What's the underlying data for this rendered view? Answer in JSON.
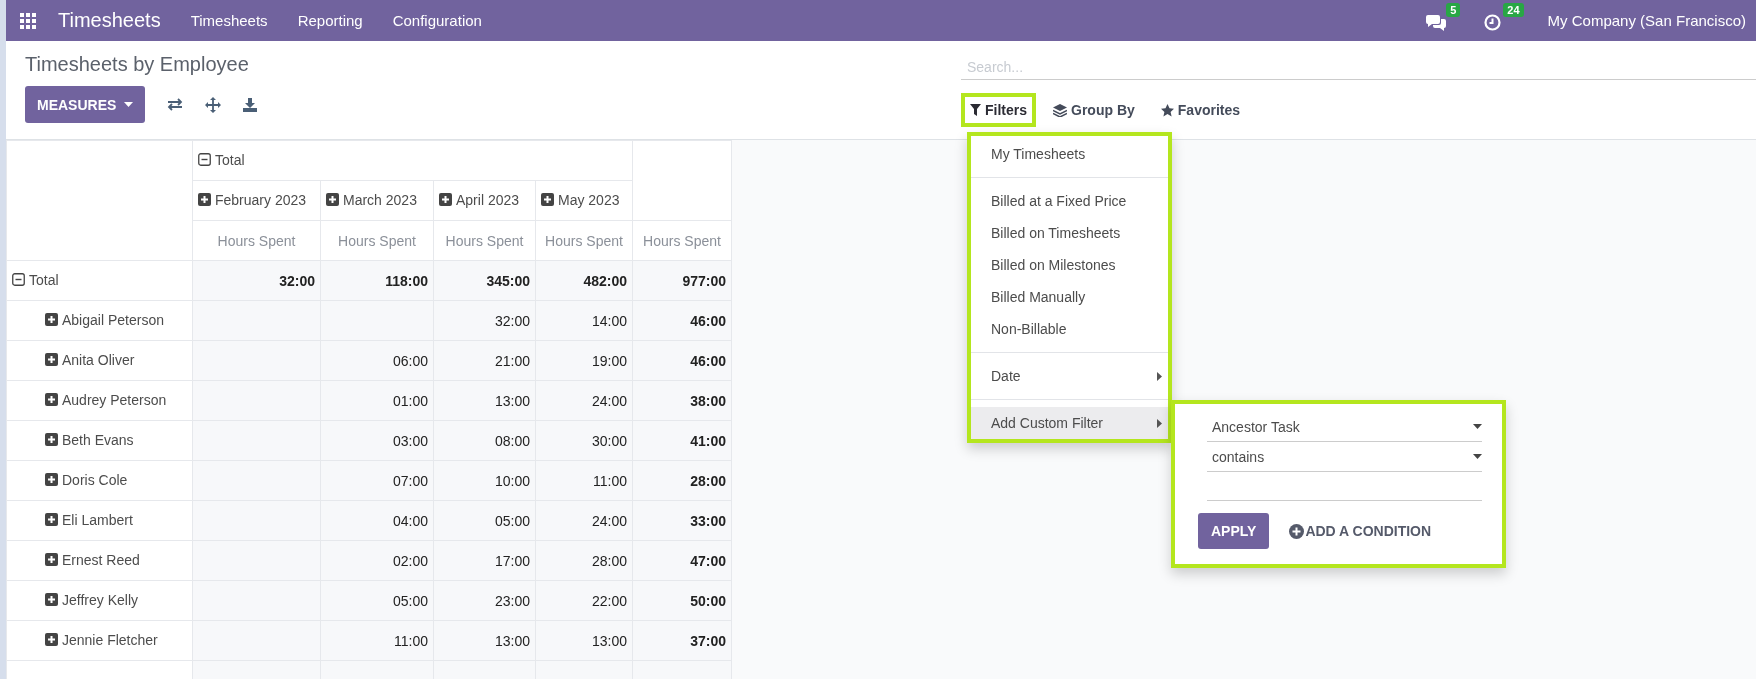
{
  "navbar": {
    "app_name": "Timesheets",
    "menus": [
      "Timesheets",
      "Reporting",
      "Configuration"
    ],
    "messages_count": "5",
    "activities_count": "24",
    "company": "My Company (San Francisco)"
  },
  "page_title": "Timesheets by Employee",
  "toolbar": {
    "measures_label": "MEASURES"
  },
  "search": {
    "placeholder": "Search..."
  },
  "filter_tabs": [
    {
      "label": "Filters",
      "selected": true
    },
    {
      "label": "Group By",
      "selected": false
    },
    {
      "label": "Favorites",
      "selected": false
    }
  ],
  "filter_menu": {
    "groups": [
      [
        {
          "label": "My Timesheets",
          "submenu": false,
          "selected": false
        }
      ],
      [
        {
          "label": "Billed at a Fixed Price",
          "submenu": false,
          "selected": false
        },
        {
          "label": "Billed on Timesheets",
          "submenu": false,
          "selected": false
        },
        {
          "label": "Billed on Milestones",
          "submenu": false,
          "selected": false
        },
        {
          "label": "Billed Manually",
          "submenu": false,
          "selected": false
        },
        {
          "label": "Non-Billable",
          "submenu": false,
          "selected": false
        }
      ],
      [
        {
          "label": "Date",
          "submenu": true,
          "selected": false
        }
      ],
      [
        {
          "label": "Add Custom Filter",
          "submenu": true,
          "selected": true
        }
      ]
    ]
  },
  "custom_filter": {
    "field": "Ancestor Task",
    "operator": "contains",
    "apply_label": "APPLY",
    "add_condition_label": "ADD A CONDITION"
  },
  "pivot": {
    "column_header": {
      "label": "Total",
      "expanded": true
    },
    "months": [
      {
        "label": "February 2023",
        "expanded": false
      },
      {
        "label": "March 2023",
        "expanded": false
      },
      {
        "label": "April 2023",
        "expanded": false
      },
      {
        "label": "May 2023",
        "expanded": false
      }
    ],
    "measures": [
      "Hours Spent",
      "Hours Spent",
      "Hours Spent",
      "Hours Spent",
      "Hours Spent"
    ],
    "total_row": {
      "label": "Total",
      "expanded": true,
      "values": [
        "32:00",
        "118:00",
        "345:00",
        "482:00",
        "977:00"
      ]
    },
    "rows": [
      {
        "label": "Abigail Peterson",
        "expanded": false,
        "values": [
          "32:00",
          "14:00",
          "46:00"
        ]
      },
      {
        "label": "Anita Oliver",
        "expanded": false,
        "values": [
          "06:00",
          "21:00",
          "19:00",
          "46:00"
        ]
      },
      {
        "label": "Audrey Peterson",
        "expanded": false,
        "values": [
          "01:00",
          "13:00",
          "24:00",
          "38:00"
        ]
      },
      {
        "label": "Beth Evans",
        "expanded": false,
        "values": [
          "03:00",
          "08:00",
          "30:00",
          "41:00"
        ]
      },
      {
        "label": "Doris Cole",
        "expanded": false,
        "values": [
          "07:00",
          "10:00",
          "11:00",
          "28:00"
        ]
      },
      {
        "label": "Eli Lambert",
        "expanded": false,
        "values": [
          "04:00",
          "05:00",
          "24:00",
          "33:00"
        ]
      },
      {
        "label": "Ernest Reed",
        "expanded": false,
        "values": [
          "02:00",
          "17:00",
          "28:00",
          "47:00"
        ]
      },
      {
        "label": "Jeffrey Kelly",
        "expanded": false,
        "values": [
          "05:00",
          "23:00",
          "22:00",
          "50:00"
        ]
      },
      {
        "label": "Jennie Fletcher",
        "expanded": false,
        "values": [
          "11:00",
          "13:00",
          "13:00",
          "37:00"
        ]
      }
    ]
  }
}
